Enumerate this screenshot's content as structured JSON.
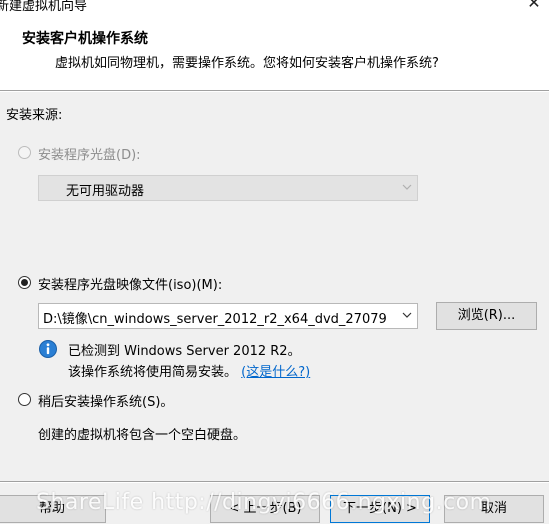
{
  "window": {
    "title": "新建虚拟机向导",
    "close_glyph": "✕"
  },
  "header": {
    "title": "安装客户机操作系统",
    "subtitle": "虚拟机如同物理机，需要操作系统。您将如何安装客户机操作系统?"
  },
  "source": {
    "label": "安装来源:",
    "disc": {
      "label": "安装程序光盘(D):",
      "selected": false,
      "enabled": false,
      "drive_value": "无可用驱动器"
    },
    "iso": {
      "label": "安装程序光盘映像文件(iso)(M):",
      "selected": true,
      "path_value": "D:\\镜像\\cn_windows_server_2012_r2_x64_dvd_27079",
      "browse_label": "浏览(R)...",
      "detected_text": "已检测到 Windows Server 2012 R2。",
      "easy_install_text": "该操作系统将使用简易安装。",
      "whats_this_link": "(这是什么?)"
    },
    "later": {
      "label": "稍后安装操作系统(S)。",
      "selected": false,
      "description": "创建的虚拟机将包含一个空白硬盘。"
    }
  },
  "footer": {
    "help_label": "帮助",
    "back_label": "< 上一步(B)",
    "next_label": "下一步(N) >",
    "cancel_label": "取消",
    "watermark": "ShareLife   http://dingyi6666.ngxing.com"
  },
  "icons": {
    "info": "info-icon",
    "dropdown": "chevron-down-icon",
    "close": "close-icon"
  },
  "colors": {
    "background": "#f0f0f0",
    "header_background": "#ffffff",
    "link": "#0066cc",
    "primary_border": "#0078d7",
    "info_icon": "#2a7fd4"
  }
}
